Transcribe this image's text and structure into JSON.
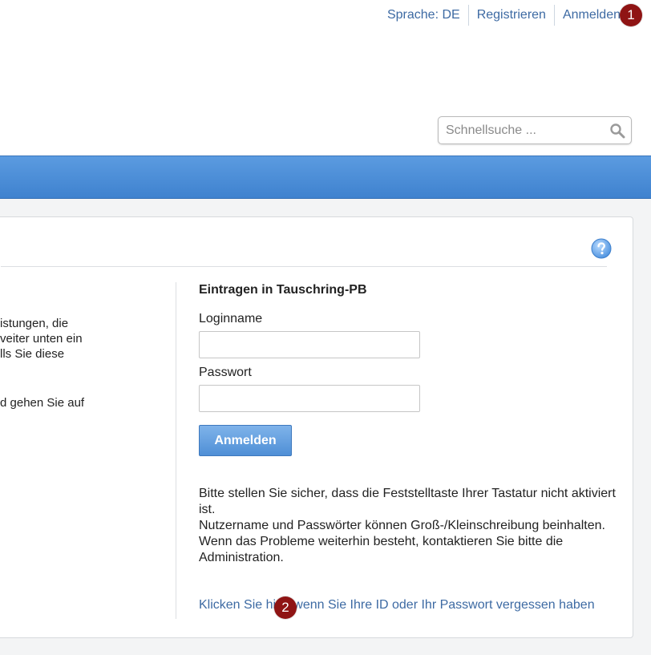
{
  "header": {
    "language_link": "Sprache: DE",
    "register_link": "Registrieren",
    "login_link": "Anmelden"
  },
  "search": {
    "placeholder": "Schnellsuche ..."
  },
  "left_column": {
    "lines": [
      "istungen, die",
      "veiter unten ein",
      "lls Sie diese",
      "d gehen Sie auf"
    ]
  },
  "login_form": {
    "title": "Eintragen in Tauschring-PB",
    "loginname_label": "Loginname",
    "loginname_value": "",
    "password_label": "Passwort",
    "password_value": "",
    "submit_label": "Anmelden",
    "hints": [
      "Bitte stellen Sie sicher, dass die Feststelltaste Ihrer Tastatur nicht aktiviert ist.",
      "Nutzername und Passwörter können Groß-/Kleinschreibung beinhalten.",
      "Wenn das Probleme weiterhin besteht, kontaktieren Sie bitte die Administration."
    ],
    "forgot_link": "Klicken Sie hier, wenn Sie Ihre ID oder Ihr Passwort vergessen haben"
  },
  "badges": {
    "first": "1",
    "second": "2"
  },
  "colors": {
    "link": "#3d6aa3",
    "nav_bar": "#4a8ed8",
    "button": "#5f9de0",
    "badge": "#8f1414"
  }
}
